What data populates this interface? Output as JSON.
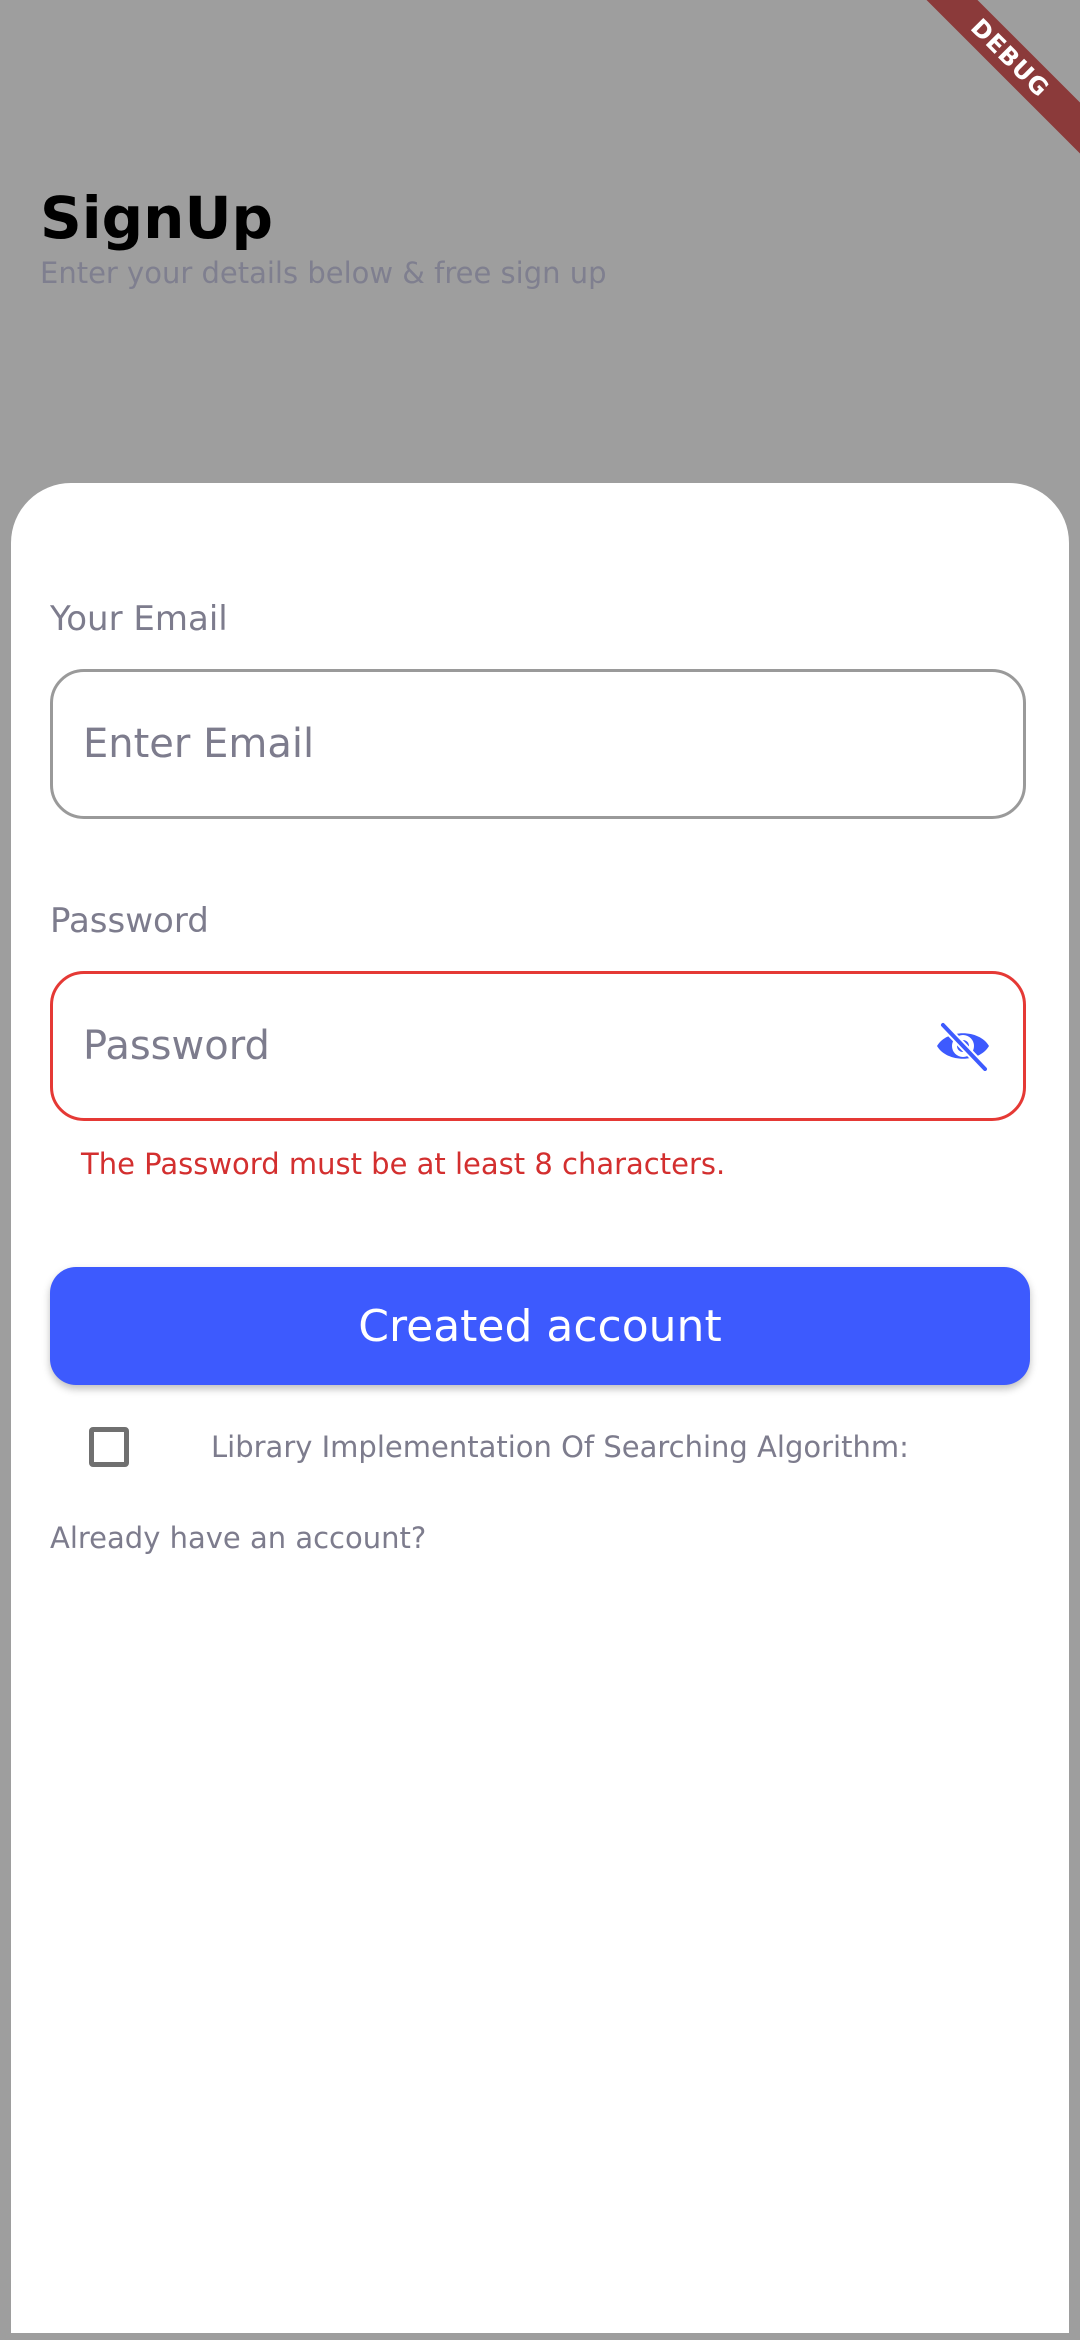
{
  "debug_label": "DEBUG",
  "header": {
    "title": "SignUp",
    "subtitle": "Enter your details below & free sign up"
  },
  "form": {
    "email": {
      "label": "Your Email",
      "placeholder": "Enter Email",
      "value": ""
    },
    "password": {
      "label": "Password",
      "placeholder": "Password",
      "value": "",
      "error": "The Password must be at least 8 characters.",
      "toggle_icon": "eye-off-icon"
    },
    "submit_label": "Created account",
    "checkbox": {
      "label": "Library Implementation Of Searching Algorithm:",
      "checked": false
    },
    "login_prompt": "Already have an account?"
  },
  "colors": {
    "background": "#9e9e9e",
    "primary": "#3d5afe",
    "error": "#d32f2f",
    "muted_text": "#7d7c8d",
    "debug_ribbon": "#8b3a3a"
  }
}
